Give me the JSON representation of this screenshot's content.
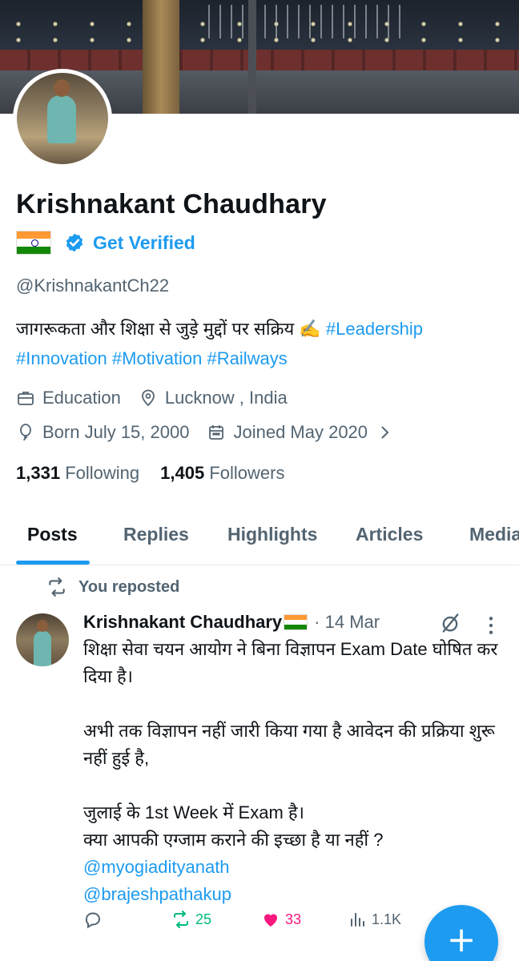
{
  "profile": {
    "name": "Krishnakant Chaudhary",
    "get_verified": "Get Verified",
    "handle": "@KrishnakantCh22",
    "bio_text": "जागरूकता और शिक्षा से जुड़े मुद्दों पर सक्रिय ✍️",
    "bio_tag1": "#Leadership",
    "bio_tag2": "#Innovation",
    "bio_tag3": "#Motivation",
    "bio_tag4": "#Railways",
    "category": "Education",
    "location": "Lucknow , India",
    "born": "Born July 15, 2000",
    "joined": "Joined May 2020",
    "following_count": "1,331",
    "following_label": "Following",
    "followers_count": "1,405",
    "followers_label": "Followers"
  },
  "tabs": [
    "Posts",
    "Replies",
    "Highlights",
    "Articles",
    "Media"
  ],
  "active_tab": "Posts",
  "post": {
    "repost_label": "You reposted",
    "author": "Krishnakant Chaudhary",
    "date": "· 14 Mar",
    "paragraph1": "शिक्षा सेवा चयन आयोग ने बिना विज्ञापन Exam Date घोषित कर दिया है।",
    "paragraph2": "अभी तक विज्ञापन नहीं जारी किया गया है आवेदन की प्रक्रिया शुरू नहीं हुई है,",
    "paragraph3": "जुलाई के 1st Week में Exam है।\nक्या आपकी एग्जाम कराने की इच्छा है या नहीं ?",
    "mention1": "@myogiadityanath",
    "mention2": "@brajeshpathakup",
    "retweets": "25",
    "likes": "33",
    "views": "1.1K"
  },
  "colors": {
    "accent": "#1d9bf0",
    "retweet": "#00ba7c",
    "like": "#f91880",
    "muted": "#536471"
  },
  "icons": [
    "briefcase-icon",
    "location-pin-icon",
    "balloon-icon",
    "calendar-icon",
    "chevron-right-icon",
    "verified-badge-icon",
    "repost-icon",
    "grok-icon",
    "more-icon",
    "reply-icon",
    "retweet-icon",
    "like-icon",
    "views-icon",
    "compose-plus-icon"
  ]
}
